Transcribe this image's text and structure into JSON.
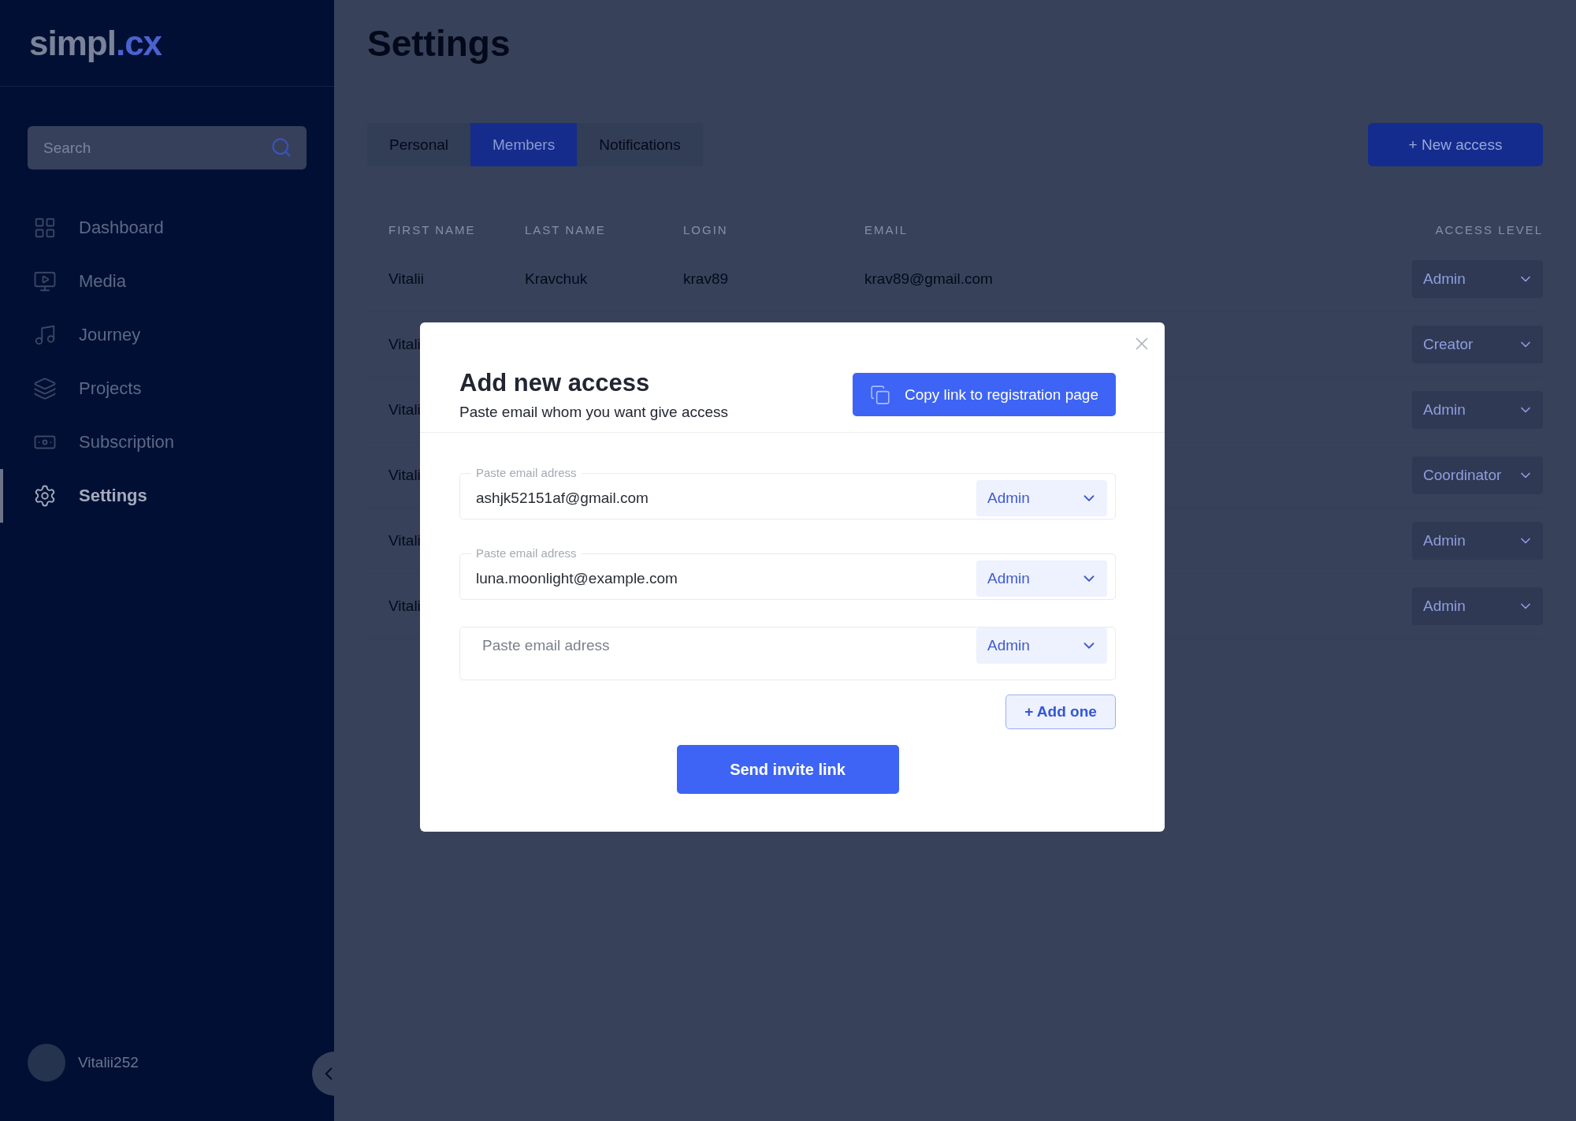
{
  "sidebar": {
    "logo": {
      "name": "simpl",
      "accent": ".cx"
    },
    "search": {
      "placeholder": "Search"
    },
    "nav": [
      {
        "label": "Dashboard",
        "selected": false
      },
      {
        "label": "Media",
        "selected": false
      },
      {
        "label": "Journey",
        "selected": false
      },
      {
        "label": "Projects",
        "selected": false
      },
      {
        "label": "Subscription",
        "selected": false
      },
      {
        "label": "Settings",
        "selected": true
      }
    ],
    "user": {
      "name": "Vitalii252"
    }
  },
  "main": {
    "title": "Settings",
    "tabs": [
      {
        "label": "Personal",
        "selected": false
      },
      {
        "label": "Members",
        "selected": true
      },
      {
        "label": "Notifications",
        "selected": false
      }
    ],
    "new_access_button": "+ New access",
    "table": {
      "columns": [
        "FIRST NAME",
        "LAST NAME",
        "LOGIN",
        "EMAIL",
        "ACCESS LEVEL"
      ],
      "rows": [
        {
          "first_name": "Vitalii",
          "last_name": "Kravchuk",
          "login": "krav89",
          "email": "krav89@gmail.com",
          "access_level": "Admin"
        },
        {
          "first_name": "Vitali",
          "access_level": "Creator"
        },
        {
          "first_name": "Vitali",
          "access_level": "Admin"
        },
        {
          "first_name": "Vitali",
          "access_level": "Coordinator"
        },
        {
          "first_name": "Vitali",
          "access_level": "Admin"
        },
        {
          "first_name": "Vitali",
          "access_level": "Admin"
        }
      ]
    }
  },
  "modal": {
    "title": "Add new access",
    "subtitle": "Paste email whom you want give access",
    "copy_button": "Copy link to registration page",
    "entries": [
      {
        "label": "Paste email adress",
        "value": "ashjk52151af@gmail.com",
        "role": "Admin"
      },
      {
        "label": "Paste email adress",
        "value": "luna.moonlight@example.com",
        "role": "Admin"
      },
      {
        "placeholder": "Paste email adress",
        "role": "Admin"
      }
    ],
    "add_button": "+ Add one",
    "submit_button": "Send invite link"
  }
}
